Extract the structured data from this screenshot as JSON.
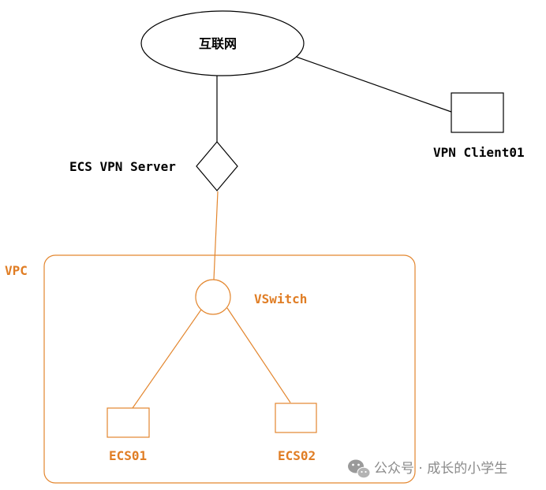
{
  "nodes": {
    "internet": {
      "label": "互联网"
    },
    "vpn_server": {
      "label": "ECS VPN Server"
    },
    "vpn_client": {
      "label": "VPN Client01"
    },
    "vpc": {
      "label": "VPC"
    },
    "vswitch": {
      "label": "VSwitch"
    },
    "ecs01": {
      "label": "ECS01"
    },
    "ecs02": {
      "label": "ECS02"
    }
  },
  "watermark": {
    "text": "公众号 · 成长的小学生",
    "icon": "wechat-icon"
  },
  "colors": {
    "line_black": "#000000",
    "accent_orange": "#e3862e",
    "label_orange": "#e07d24",
    "watermark_gray": "#8a8a8a"
  }
}
